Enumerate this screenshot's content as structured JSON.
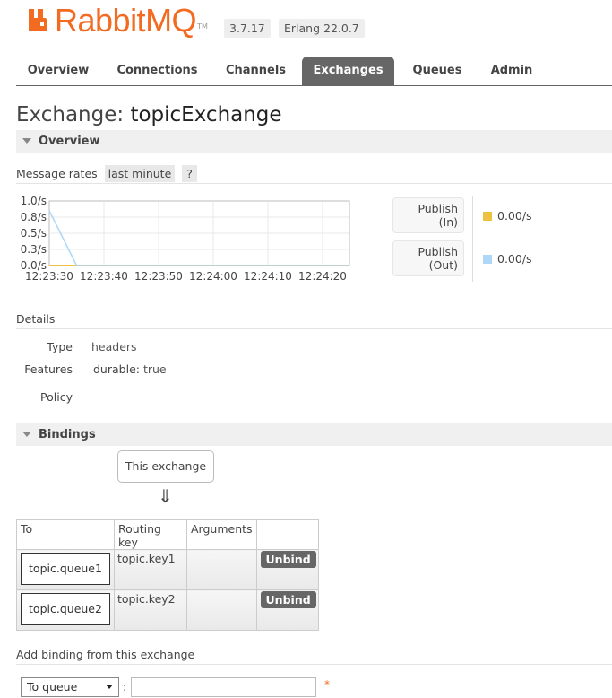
{
  "brand": {
    "logo_text": "RabbitMQ",
    "tm": "TM",
    "color": "#f36a21"
  },
  "versions": [
    "3.7.17",
    "Erlang 22.0.7"
  ],
  "nav": {
    "tabs": [
      {
        "label": "Overview",
        "active": false
      },
      {
        "label": "Connections",
        "active": false
      },
      {
        "label": "Channels",
        "active": false
      },
      {
        "label": "Exchanges",
        "active": true
      },
      {
        "label": "Queues",
        "active": false
      },
      {
        "label": "Admin",
        "active": false
      }
    ]
  },
  "page": {
    "title_prefix": "Exchange:",
    "title_name": "topicExchange"
  },
  "overview": {
    "heading": "Overview",
    "message_rates_label": "Message rates",
    "range_label": "last minute",
    "help_label": "?"
  },
  "chart_data": {
    "type": "line",
    "title": "",
    "xlabel": "",
    "ylabel": "",
    "y_tick_labels": [
      "1.0/s",
      "0.8/s",
      "0.5/s",
      "0.3/s",
      "0.0/s"
    ],
    "x_tick_labels": [
      "12:23:30",
      "12:23:40",
      "12:23:50",
      "12:24:00",
      "12:24:10",
      "12:24:20"
    ],
    "ylim": [
      0,
      1.0
    ],
    "grid": true,
    "series": [
      {
        "name": "Publish (In)",
        "color": "#edc240",
        "x": [
          "12:23:30",
          "12:23:35",
          "12:24:25"
        ],
        "values": [
          0.0,
          0.0,
          0.0
        ]
      },
      {
        "name": "Publish (Out)",
        "color": "#afd8f8",
        "x": [
          "12:23:30",
          "12:23:35",
          "12:24:25"
        ],
        "values": [
          0.85,
          0.0,
          0.0
        ]
      }
    ]
  },
  "rates": [
    {
      "label_line1": "Publish",
      "label_line2": "(In)",
      "value": "0.00/s",
      "color": "#edc240"
    },
    {
      "label_line1": "Publish",
      "label_line2": "(Out)",
      "value": "0.00/s",
      "color": "#afd8f8"
    }
  ],
  "details": {
    "heading": "Details",
    "type_label": "Type",
    "type_value": "headers",
    "features_label": "Features",
    "durable_key": "durable:",
    "durable_value": "true",
    "policy_label": "Policy"
  },
  "bindings": {
    "heading": "Bindings",
    "this_exchange": "This exchange",
    "arrow": "⇓",
    "columns": [
      "To",
      "Routing key",
      "Arguments",
      ""
    ],
    "rows": [
      {
        "to": "topic.queue1",
        "routing_key": "topic.key1",
        "arguments": "",
        "action": "Unbind"
      },
      {
        "to": "topic.queue2",
        "routing_key": "topic.key2",
        "arguments": "",
        "action": "Unbind"
      }
    ]
  },
  "add_binding": {
    "heading": "Add binding from this exchange",
    "destination_type": "To queue",
    "colon": ":",
    "destination_value": "",
    "required_mark": "*"
  }
}
